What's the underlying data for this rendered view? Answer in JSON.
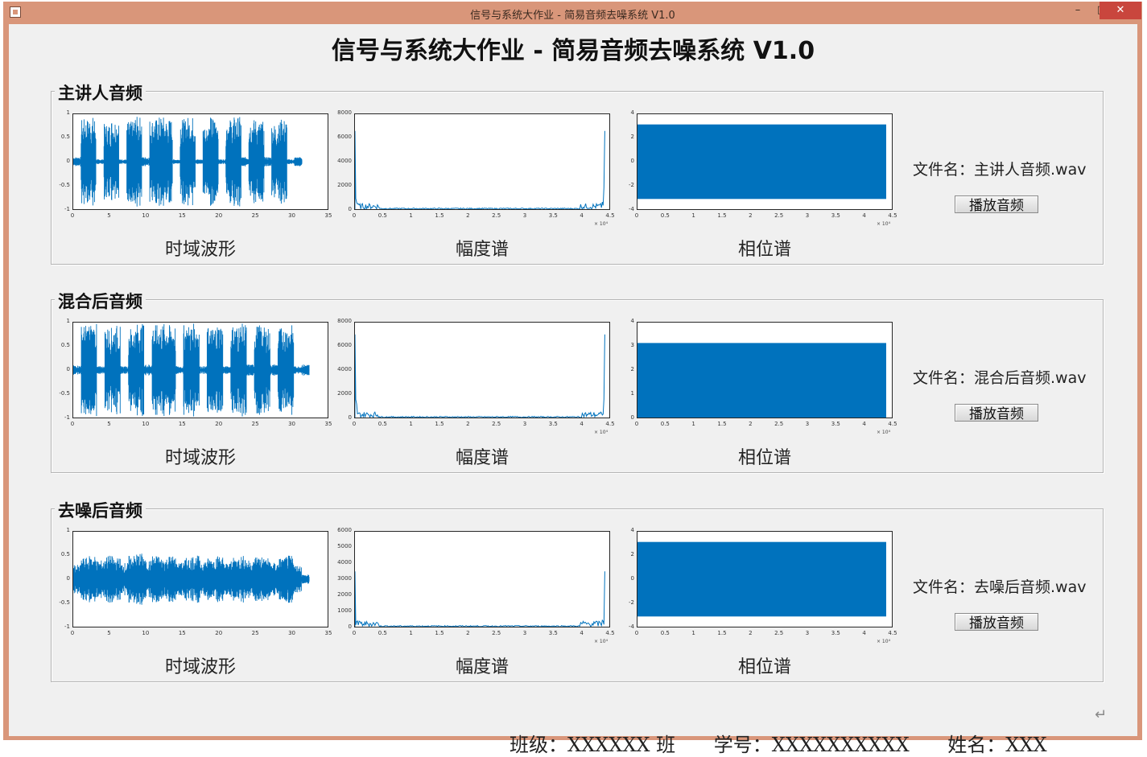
{
  "window": {
    "title": "信号与系统大作业 - 简易音频去噪系统 V1.0",
    "controls": {
      "minimize": "–",
      "maximize": "□",
      "close": "✕"
    }
  },
  "app": {
    "title": "信号与系统大作业 - 简易音频去噪系统 V1.0"
  },
  "panels": [
    {
      "title": "主讲人音频",
      "file_label": "文件名：",
      "file_name": "主讲人音频.wav",
      "play_button": "播放音频",
      "captions": [
        "时域波形",
        "幅度谱",
        "相位谱"
      ],
      "chart_data": [
        {
          "type": "line",
          "title": "",
          "xlabel": "",
          "ylabel": "",
          "x_ticks": [
            "0",
            "5",
            "10",
            "15",
            "20",
            "25",
            "30",
            "35"
          ],
          "y_ticks": [
            "1",
            "0.5",
            "0",
            "-0.5",
            "-1"
          ],
          "xlim": [
            0,
            35
          ],
          "ylim": [
            -1,
            1
          ],
          "series": [
            {
              "amplitude_envelope_seg": [
                0.1,
                0.9,
                0.95,
                0.05,
                0.8,
                0.9,
                0.05,
                0.85,
                0.95,
                0.1,
                0.9,
                0.95,
                0.9,
                0.05,
                0.9,
                0.95,
                0.05,
                0.8,
                0.95,
                0.05,
                0.9,
                0.95,
                0.1,
                0.9,
                0.85,
                0.1,
                0.8,
                0.9,
                0.05,
                0.1
              ],
              "end": 31.5
            }
          ]
        },
        {
          "type": "line",
          "title": "",
          "xlabel": "",
          "ylabel": "",
          "x_ticks": [
            "0",
            "0.5",
            "1",
            "1.5",
            "2",
            "2.5",
            "3",
            "3.5",
            "4",
            "4.5"
          ],
          "y_ticks": [
            "8000",
            "6000",
            "4000",
            "2000",
            "0"
          ],
          "x_exponent": "× 10⁴",
          "xlim": [
            0,
            4.5
          ],
          "ylim": [
            0,
            8000
          ],
          "series": [
            {
              "peak_left": 6600,
              "peak_right": 6600
            }
          ]
        },
        {
          "type": "area",
          "title": "",
          "xlabel": "",
          "ylabel": "",
          "x_ticks": [
            "0",
            "0.5",
            "1",
            "1.5",
            "2",
            "2.5",
            "3",
            "3.5",
            "4",
            "4.5"
          ],
          "y_ticks": [
            "4",
            "2",
            "0",
            "-2",
            "-4"
          ],
          "x_exponent": "× 10⁴",
          "xlim": [
            0,
            4.5
          ],
          "ylim": [
            -4,
            4
          ],
          "series": [
            {
              "band_low": -3.14,
              "band_high": 3.14,
              "x_end": 4.4
            }
          ]
        }
      ]
    },
    {
      "title": "混合后音频",
      "file_label": "文件名：",
      "file_name": "混合后音频.wav",
      "play_button": "播放音频",
      "captions": [
        "时域波形",
        "幅度谱",
        "相位谱"
      ],
      "chart_data": [
        {
          "type": "line",
          "title": "",
          "xlabel": "",
          "ylabel": "",
          "x_ticks": [
            "0",
            "5",
            "10",
            "15",
            "20",
            "25",
            "30",
            "35"
          ],
          "y_ticks": [
            "1",
            "0.5",
            "0",
            "-0.5",
            "-1"
          ],
          "xlim": [
            0,
            35
          ],
          "ylim": [
            -1,
            1
          ],
          "series": [
            {
              "amplitude_envelope_seg": [
                0.1,
                0.95,
                0.98,
                0.08,
                0.9,
                0.95,
                0.08,
                0.9,
                0.98,
                0.12,
                0.95,
                0.98,
                0.95,
                0.08,
                0.95,
                0.98,
                0.08,
                0.9,
                0.98,
                0.08,
                0.95,
                0.98,
                0.12,
                0.95,
                0.9,
                0.12,
                0.9,
                0.95,
                0.08,
                0.12
              ],
              "end": 32.5
            }
          ]
        },
        {
          "type": "line",
          "title": "",
          "xlabel": "",
          "ylabel": "",
          "x_ticks": [
            "0",
            "0.5",
            "1",
            "1.5",
            "2",
            "2.5",
            "3",
            "3.5",
            "4",
            "4.5"
          ],
          "y_ticks": [
            "8000",
            "6000",
            "4000",
            "2000",
            "0"
          ],
          "x_exponent": "× 10⁴",
          "xlim": [
            0,
            4.5
          ],
          "ylim": [
            0,
            8000
          ],
          "series": [
            {
              "peak_left": 7000,
              "peak_right": 7000
            }
          ]
        },
        {
          "type": "area",
          "title": "",
          "xlabel": "",
          "ylabel": "",
          "x_ticks": [
            "0",
            "0.5",
            "1",
            "1.5",
            "2",
            "2.5",
            "3",
            "3.5",
            "4",
            "4.5"
          ],
          "y_ticks": [
            "4",
            "3",
            "2",
            "1",
            "0"
          ],
          "x_exponent": "× 10⁴",
          "xlim": [
            0,
            4.5
          ],
          "ylim": [
            0,
            4
          ],
          "series": [
            {
              "band_low": 0,
              "band_high": 3.14,
              "x_end": 4.4
            }
          ]
        }
      ]
    },
    {
      "title": "去噪后音频",
      "file_label": "文件名：",
      "file_name": "去噪后音频.wav",
      "play_button": "播放音频",
      "captions": [
        "时域波形",
        "幅度谱",
        "相位谱"
      ],
      "chart_data": [
        {
          "type": "line",
          "title": "",
          "xlabel": "",
          "ylabel": "",
          "x_ticks": [
            "0",
            "5",
            "10",
            "15",
            "20",
            "25",
            "30",
            "35"
          ],
          "y_ticks": [
            "1",
            "0.5",
            "0",
            "-0.5",
            "-1"
          ],
          "xlim": [
            0,
            35
          ],
          "ylim": [
            -1,
            1
          ],
          "series": [
            {
              "amplitude_envelope_seg": [
                0.3,
                0.45,
                0.5,
                0.4,
                0.5,
                0.45,
                0.35,
                0.5,
                0.55,
                0.4,
                0.5,
                0.45,
                0.5,
                0.35,
                0.45,
                0.5,
                0.4,
                0.45,
                0.5,
                0.35,
                0.45,
                0.5,
                0.4,
                0.5,
                0.45,
                0.35,
                0.45,
                0.5,
                0.3,
                0.1
              ],
              "end": 32.5
            }
          ]
        },
        {
          "type": "line",
          "title": "",
          "xlabel": "",
          "ylabel": "",
          "x_ticks": [
            "0",
            "0.5",
            "1",
            "1.5",
            "2",
            "2.5",
            "3",
            "3.5",
            "4",
            "4.5"
          ],
          "y_ticks": [
            "6000",
            "5000",
            "4000",
            "3000",
            "2000",
            "1000",
            "0"
          ],
          "x_exponent": "× 10⁴",
          "xlim": [
            0,
            4.5
          ],
          "ylim": [
            0,
            6000
          ],
          "series": [
            {
              "peak_left": 3500,
              "peak_right": 3500
            }
          ]
        },
        {
          "type": "area",
          "title": "",
          "xlabel": "",
          "ylabel": "",
          "x_ticks": [
            "0",
            "0.5",
            "1",
            "1.5",
            "2",
            "2.5",
            "3",
            "3.5",
            "4",
            "4.5"
          ],
          "y_ticks": [
            "4",
            "2",
            "0",
            "-2",
            "-4"
          ],
          "x_exponent": "× 10⁴",
          "xlim": [
            0,
            4.5
          ],
          "ylim": [
            -4,
            4
          ],
          "series": [
            {
              "band_low": -3.14,
              "band_high": 3.14,
              "x_end": 4.4
            }
          ]
        }
      ]
    }
  ],
  "footer": {
    "class_label": "班级：XXXXXX 班",
    "id_label": "学号：XXXXXXXXXX",
    "name_label": "姓名：XXX"
  },
  "colors": {
    "plot_line": "#0072bd",
    "window_frame": "#d9967a",
    "client_bg": "#f0f0f0"
  }
}
